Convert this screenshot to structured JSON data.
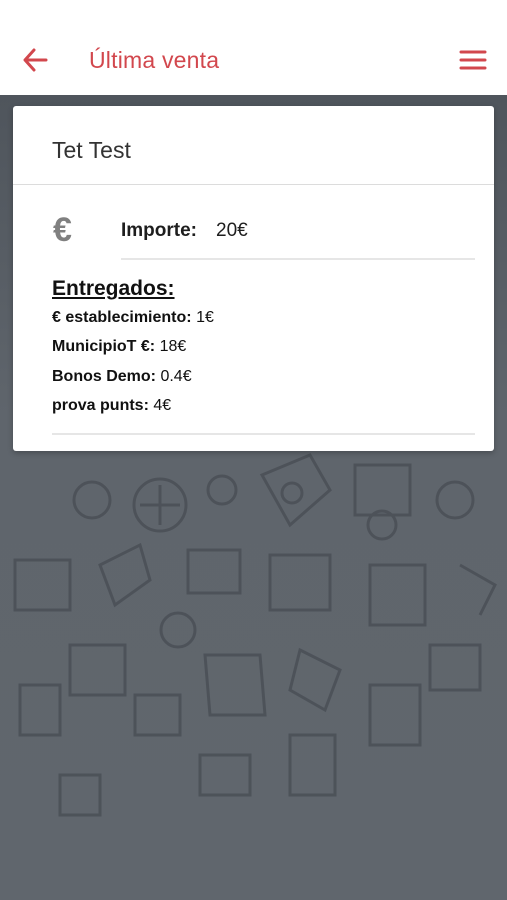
{
  "header": {
    "title": "Última venta",
    "back_icon": "arrow-left-icon",
    "menu_icon": "hamburger-menu-icon",
    "accent_color": "#d2474d"
  },
  "card": {
    "store_name": "Tet Test",
    "currency_icon": "euro-icon",
    "currency_symbol": "€",
    "importe_label": "Importe:",
    "importe_value": "20€",
    "entregados_title": "Entregados:",
    "entregados": [
      {
        "label": "€ establecimiento:",
        "value": "1€"
      },
      {
        "label": "MunicipioT €:",
        "value": "18€"
      },
      {
        "label": "Bonos Demo:",
        "value": "0.4€"
      },
      {
        "label": "prova punts:",
        "value": "4€"
      }
    ]
  }
}
